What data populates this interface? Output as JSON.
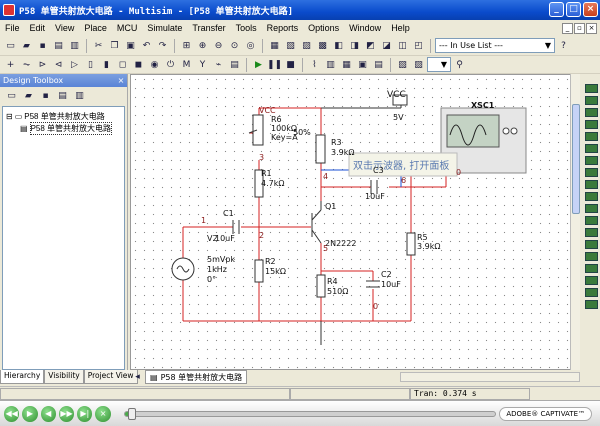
{
  "window": {
    "title": "P58 单管共射放大电路 - Multisim - [P58 单管共射放大电路]"
  },
  "menu": [
    "File",
    "Edit",
    "View",
    "Place",
    "MCU",
    "Simulate",
    "Transfer",
    "Tools",
    "Reports",
    "Options",
    "Window",
    "Help"
  ],
  "toolbar": {
    "in_use_list": "--- In Use List ---"
  },
  "toolbox": {
    "title": "Design Toolbox",
    "root": "P58 单管共射放大电路",
    "child": "P58 单管共射放大电路",
    "tabs": [
      "Hierarchy",
      "Visibility",
      "Project View"
    ]
  },
  "schematic": {
    "vcc_top": "VCC",
    "vcc_label": "VCC",
    "vcc_voltage": "5V",
    "r6": {
      "ref": "R6",
      "value": "100kΩ",
      "key": "Key=A",
      "percent": "50%"
    },
    "r3": {
      "ref": "R3",
      "value": "3.9kΩ"
    },
    "r1": {
      "ref": "R1",
      "value": "4.7kΩ"
    },
    "r2": {
      "ref": "R2",
      "value": "15kΩ"
    },
    "r4": {
      "ref": "R4",
      "value": "510Ω"
    },
    "r5": {
      "ref": "R5",
      "value": "3.9kΩ"
    },
    "c1": {
      "ref": "C1",
      "value": "10uF"
    },
    "c2": {
      "ref": "C2",
      "value": "10uF"
    },
    "c3": {
      "ref": "C3",
      "value": "10uF"
    },
    "q1": {
      "ref": "Q1",
      "model": "2N2222"
    },
    "v2": {
      "ref": "V2",
      "amp": "5mVpk",
      "freq": "1kHz",
      "phase": "0°"
    },
    "xsc1": "XSC1",
    "tooltip": "双击示波器, 打开面板",
    "nodes": {
      "n3": "3",
      "n4": "4",
      "n6": "6",
      "n0a": "0",
      "n1": "1",
      "n2": "2",
      "n5": "5",
      "n0b": "0"
    }
  },
  "doc_tab": "P58 单管共射放大电路",
  "status": {
    "tran": "Tran: 0.374 s"
  },
  "player": {
    "brand": "ADOBE® CAPTIVATE™",
    "progress": 0.02
  }
}
